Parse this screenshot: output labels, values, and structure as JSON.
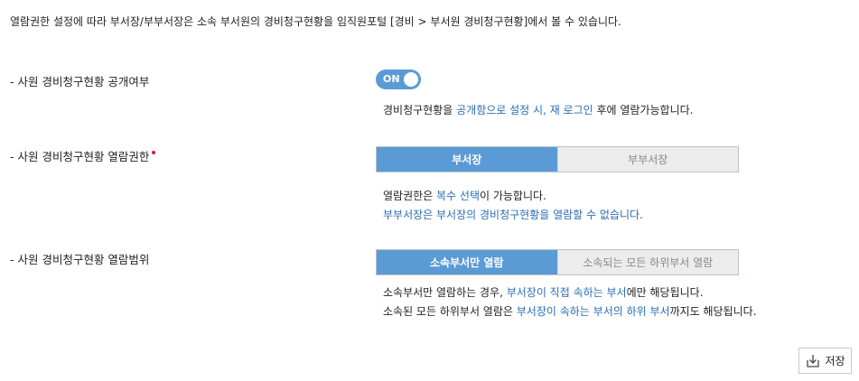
{
  "intro": "열람권한 설정에 따라 부서장/부부서장은 소속 부서원의 경비청구현황을 임직원포털 [경비 > 부서원 경비청구현황]에서 볼 수 있습니다.",
  "public_setting": {
    "label": "- 사원 경비청구현황 공개여부",
    "toggle_text": "ON",
    "desc": {
      "p1": "경비청구현황을 ",
      "h1": "공개함으로 설정 시, 재 로그인",
      "p2": " 후에 열람가능합니다."
    }
  },
  "view_permission": {
    "label": "- 사원 경비청구현황 열람권한",
    "options": [
      "부서장",
      "부부서장"
    ],
    "selected": "부서장",
    "desc": {
      "p1": "열람권한은 ",
      "h1": "복수 선택",
      "p2": "이 가능합니다.",
      "line2": "부부서장은 부서장의 경비청구현황을 열람할 수 없습니다."
    }
  },
  "view_scope": {
    "label": "- 사원 경비청구현황 열람범위",
    "options": [
      "소속부서만 열람",
      "소속되는 모든 하위부서 열람"
    ],
    "selected": "소속부서만 열람",
    "desc": {
      "l1_p1": "소속부서만 열람하는 경우, ",
      "l1_h1": "부서장이 직접 속하는 부서",
      "l1_p2": "에만 해당됩니다.",
      "l2_p1": "소속된 모든 하위부서 열람은 ",
      "l2_h1": "부서장이 속하는 부서의 하위 부서",
      "l2_p2": "까지도 해당됩니다."
    }
  },
  "save_label": "저장",
  "colors": {
    "accent": "#5b9bd5",
    "highlight_text": "#2a6db5",
    "required_dot": "#e0162b"
  }
}
